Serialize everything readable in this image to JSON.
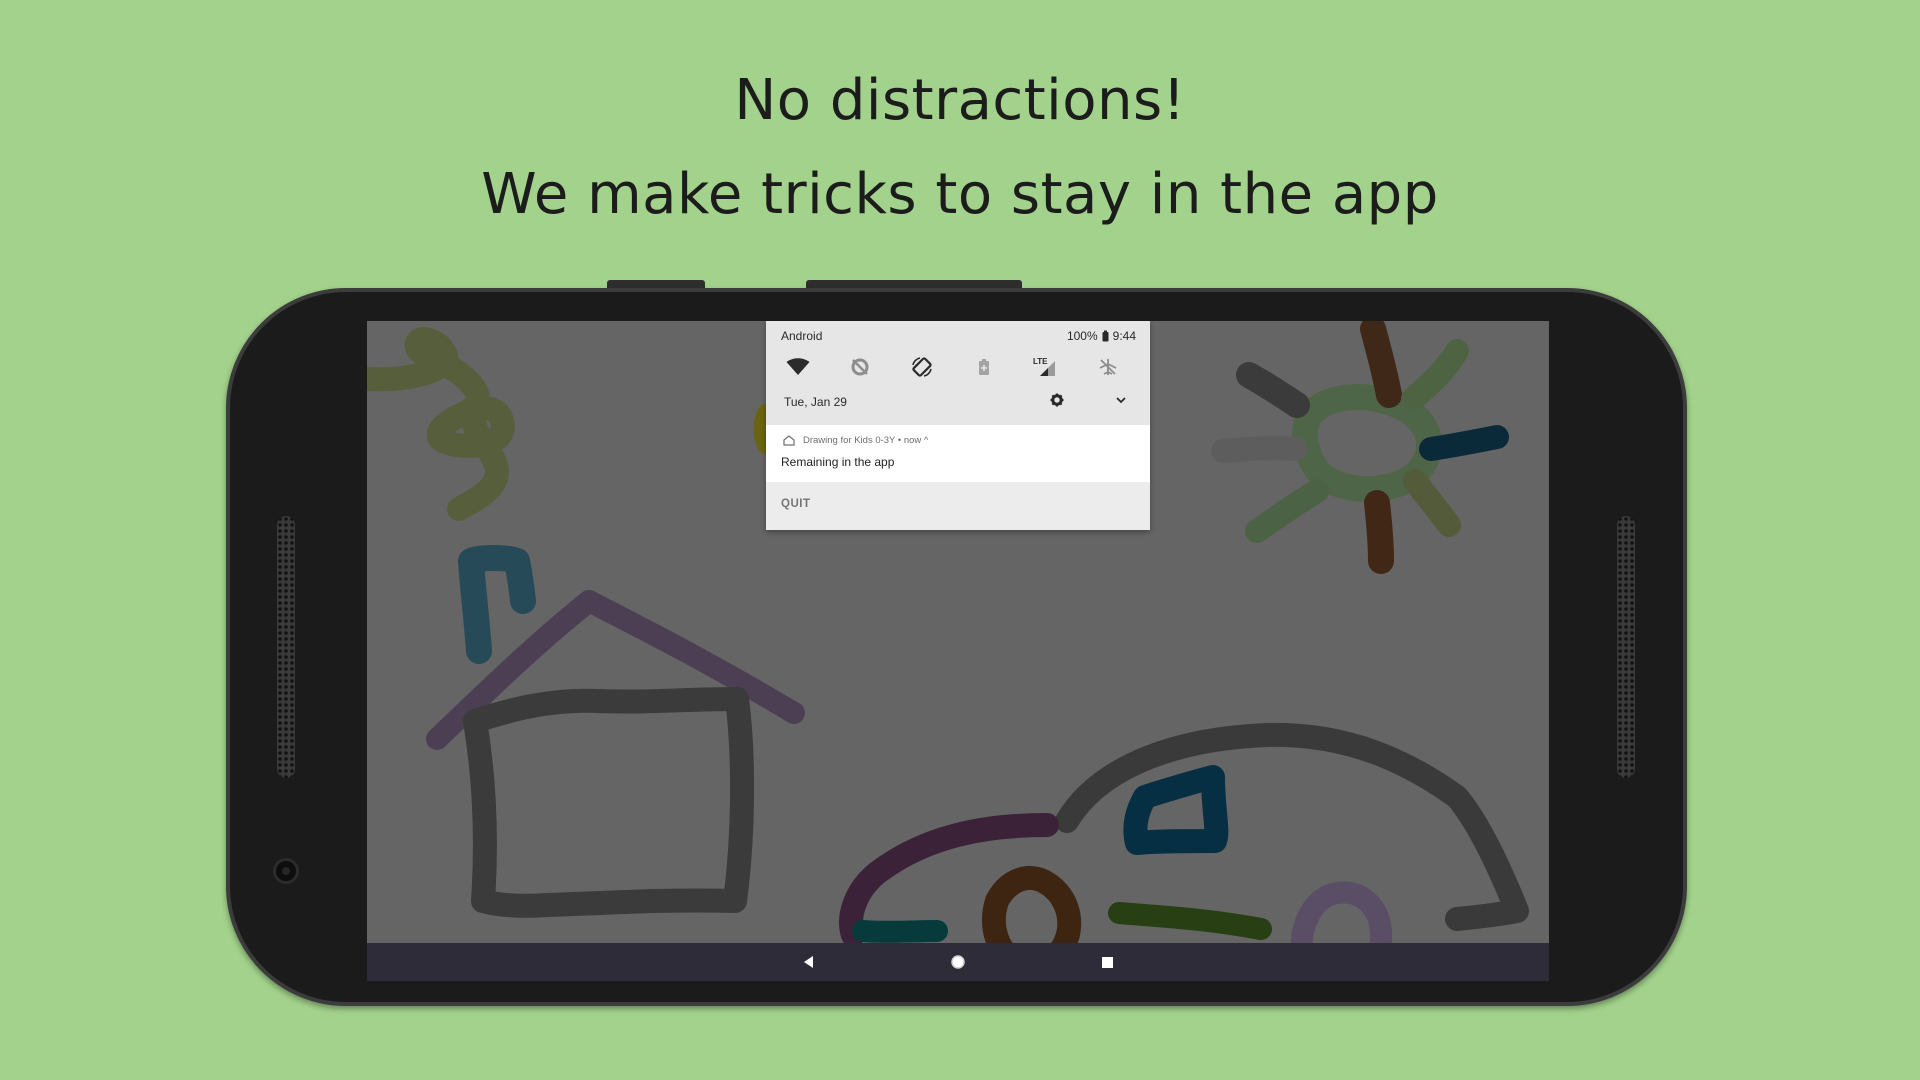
{
  "headline": {
    "line1": "No distractions!",
    "line2": "We make tricks to stay in the app"
  },
  "colors": {
    "background": "#a2d28b",
    "phone_body": "#1b1b1b",
    "screen_dim": "#656565",
    "navbar": "#2e2c39",
    "shade": "#e6e6e6"
  },
  "status_bar": {
    "carrier": "Android",
    "battery": "100%",
    "time": "9:44"
  },
  "quick_settings": {
    "icons": [
      "wifi-icon",
      "data-saver-icon",
      "auto-rotate-icon",
      "battery-saver-icon",
      "lte-signal-icon",
      "airplane-mode-icon"
    ],
    "lte_label": "LTE",
    "date": "Tue, Jan 29"
  },
  "notification": {
    "app_line": "Drawing for Kids 0-3Y • now ^",
    "text": "Remaining in the app",
    "action": "QUIT"
  },
  "nav": {
    "buttons": [
      "back-icon",
      "home-icon",
      "recents-icon"
    ]
  }
}
